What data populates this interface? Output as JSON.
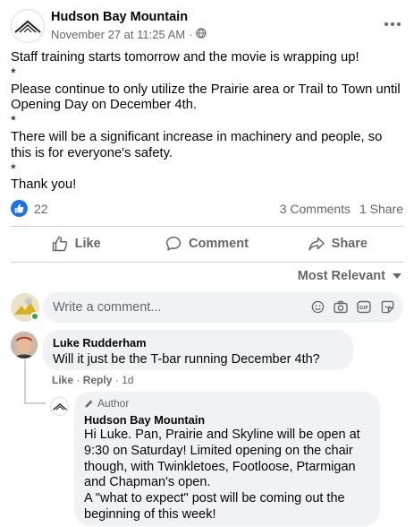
{
  "post": {
    "page_name": "Hudson Bay Mountain",
    "timestamp": "November 27 at 11:25 AM",
    "separator": "·",
    "privacy_icon": "globe-icon",
    "body": "Staff training starts tomorrow and the movie is wrapping up!\n*\nPlease continue to only utilize the Prairie area or Trail to Town until Opening Day on December 4th.\n*\nThere will be a significant increase in machinery and people, so this is for everyone's safety.\n*\nThank you!"
  },
  "reactions": {
    "count": "22",
    "comments": "3 Comments",
    "shares": "1 Share"
  },
  "actions": {
    "like": "Like",
    "comment": "Comment",
    "share": "Share"
  },
  "sort": {
    "label": "Most Relevant"
  },
  "compose": {
    "placeholder": "Write a comment..."
  },
  "comments": [
    {
      "author": "Luke Rudderham",
      "text": "Will it just be the T-bar running December 4th?",
      "like": "Like",
      "reply": "Reply",
      "time": "1d",
      "dot": "·",
      "replies": [
        {
          "badge": "Author",
          "author": "Hudson Bay Mountain",
          "text": "Hi Luke. Pan, Prairie and Skyline will be open at 9:30 on Saturday! Limited opening on the chair though, with Twinkletoes, Footloose, Ptarmigan and Chapman's open.\nA \"what to expect\" post will be coming out the beginning of this week!"
        }
      ]
    }
  ],
  "colors": {
    "accent": "#1b74e4",
    "secondary_text": "#65676b",
    "bubble": "#f0f2f5"
  }
}
